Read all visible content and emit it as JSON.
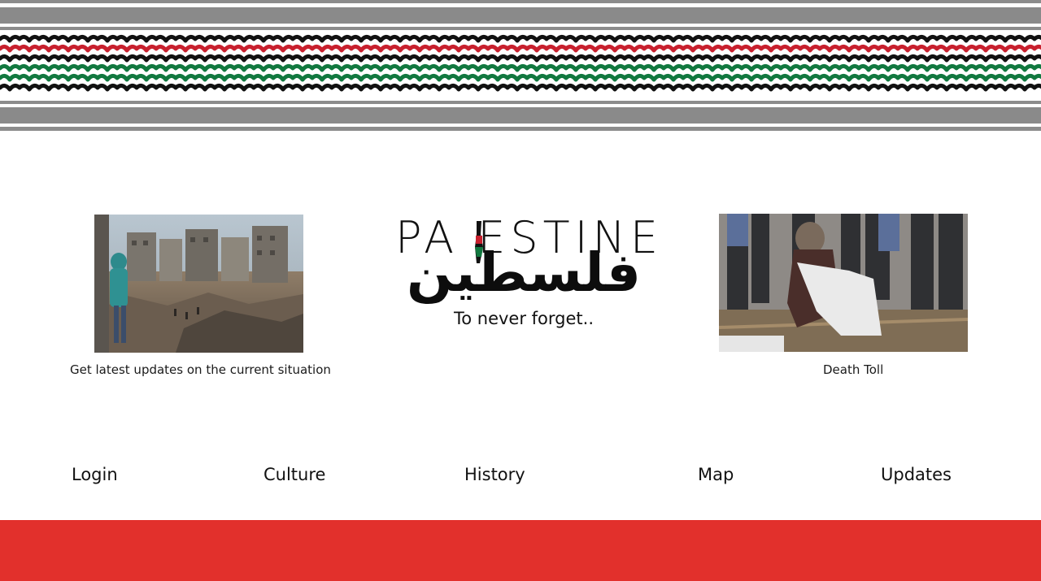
{
  "header": {
    "pattern_colors": {
      "red": "#c8202e",
      "green": "#11783f",
      "black": "#111111",
      "gray": "#8a8a8a"
    }
  },
  "left_feature": {
    "image_alt": "destroyed-buildings-photo",
    "caption": "Get latest updates on the current situation"
  },
  "logo": {
    "latin": "PA ESTINE",
    "arabic": "فلسطين",
    "tagline": "To never forget.."
  },
  "right_feature": {
    "image_alt": "mourning-photo",
    "caption": "Death Toll"
  },
  "nav": {
    "items": [
      {
        "label": "Login"
      },
      {
        "label": "Culture"
      },
      {
        "label": "History"
      },
      {
        "label": "Map"
      },
      {
        "label": "Updates"
      }
    ]
  },
  "footer": {
    "color": "#e2302c"
  }
}
